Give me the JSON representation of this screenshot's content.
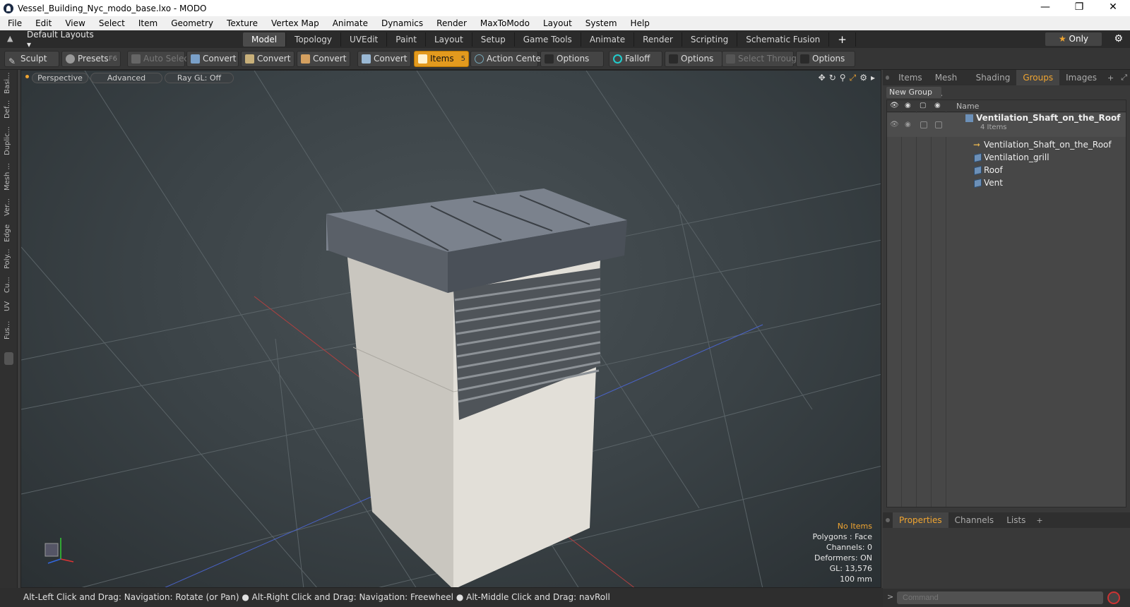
{
  "title": "Vessel_Building_Nyc_modo_base.lxo - MODO",
  "menu": [
    "File",
    "Edit",
    "View",
    "Select",
    "Item",
    "Geometry",
    "Texture",
    "Vertex Map",
    "Animate",
    "Dynamics",
    "Render",
    "MaxToModo",
    "Layout",
    "System",
    "Help"
  ],
  "layout_selector": "Default Layouts",
  "mode_tabs": [
    "Model",
    "Topology",
    "UVEdit",
    "Paint",
    "Layout",
    "Setup",
    "Game Tools",
    "Animate",
    "Render",
    "Scripting",
    "Schematic Fusion"
  ],
  "only_label": "Only",
  "tools": {
    "sculpt": "Sculpt",
    "presets": "Presets",
    "presets_key": "F6",
    "auto_select": "Auto Select",
    "convert": "Convert",
    "items": "Items",
    "items_badge": "5",
    "action_center": "Action Center",
    "options": "Options",
    "falloff": "Falloff",
    "select_through": "Select Through"
  },
  "left_tabs": [
    "Basi...",
    "Def...",
    "Duplic...",
    "Mesh ...",
    "Ver...",
    "Edge",
    "Poly...",
    "Cu...",
    "UV",
    "Fus..."
  ],
  "viewport": {
    "view": "Perspective",
    "shading": "Advanced",
    "raygl": "Ray GL: Off"
  },
  "stats": {
    "no_items": "No Items",
    "polygons": "Polygons : Face",
    "channels": "Channels: 0",
    "deformers": "Deformers: ON",
    "gl": "GL: 13,576",
    "scale": "100 mm"
  },
  "status": "Alt-Left Click and Drag: Navigation: Rotate (or Pan) ● Alt-Right Click and Drag: Navigation: Freewheel ● Alt-Middle Click and Drag: navRoll",
  "right_tabs": [
    "Items",
    "Mesh ...",
    "Shading",
    "Groups",
    "Images"
  ],
  "new_group": "New Group",
  "tree_header": "Name",
  "group": {
    "name": "Ventilation_Shaft_on_the_Roof",
    "count": "4 Items"
  },
  "children": [
    "Ventilation_Shaft_on_the_Roof",
    "Ventilation_grill",
    "Roof",
    "Vent"
  ],
  "bottom_tabs": [
    "Properties",
    "Channels",
    "Lists"
  ],
  "command_placeholder": "Command",
  "colors": {
    "accent": "#e39a1e",
    "selected_tab": "#f0a531"
  }
}
